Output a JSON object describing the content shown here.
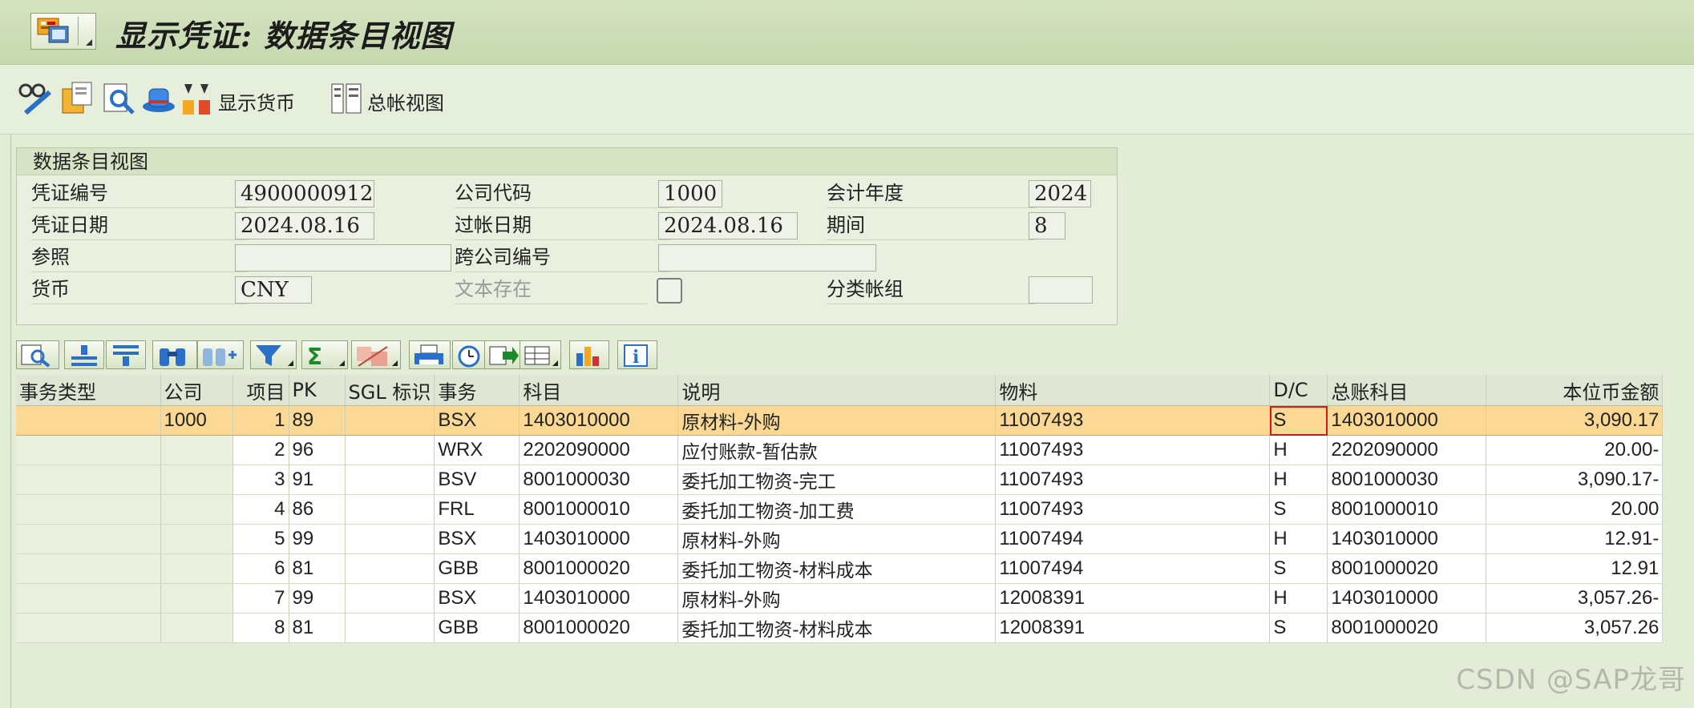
{
  "window": {
    "title": "显示凭证: 数据条目视图"
  },
  "toolbar": {
    "display_currency_label": "显示货币",
    "gl_view_label": "总帐视图"
  },
  "header": {
    "group_title": "数据条目视图",
    "doc_number_label": "凭证编号",
    "doc_number": "4900000912",
    "company_code_label": "公司代码",
    "company_code": "1000",
    "fiscal_year_label": "会计年度",
    "fiscal_year": "2024",
    "doc_date_label": "凭证日期",
    "doc_date": "2024.08.16",
    "posting_date_label": "过帐日期",
    "posting_date": "2024.08.16",
    "period_label": "期间",
    "period": "8",
    "reference_label": "参照",
    "reference": "",
    "cross_company_label": "跨公司编号",
    "cross_company": "",
    "currency_label": "货币",
    "currency": "CNY",
    "text_exists_label": "文本存在",
    "ledger_group_label": "分类帐组",
    "ledger_group": ""
  },
  "grid": {
    "columns": [
      "事务类型",
      "公司",
      "项目",
      "PK",
      "SGL 标识",
      "事务",
      "科目",
      "说明",
      "物料",
      "D/C",
      "总账科目",
      "本位币金额"
    ],
    "rows": [
      [
        "",
        "1000",
        "1",
        "89",
        "",
        "BSX",
        "1403010000",
        "原材料-外购",
        "11007493",
        "S",
        "1403010000",
        "3,090.17"
      ],
      [
        "",
        "",
        "2",
        "96",
        "",
        "WRX",
        "2202090000",
        "应付账款-暂估款",
        "11007493",
        "H",
        "2202090000",
        "20.00-"
      ],
      [
        "",
        "",
        "3",
        "91",
        "",
        "BSV",
        "8001000030",
        "委托加工物资-完工",
        "11007493",
        "H",
        "8001000030",
        "3,090.17-"
      ],
      [
        "",
        "",
        "4",
        "86",
        "",
        "FRL",
        "8001000010",
        "委托加工物资-加工费",
        "11007493",
        "S",
        "8001000010",
        "20.00"
      ],
      [
        "",
        "",
        "5",
        "99",
        "",
        "BSX",
        "1403010000",
        "原材料-外购",
        "11007494",
        "H",
        "1403010000",
        "12.91-"
      ],
      [
        "",
        "",
        "6",
        "81",
        "",
        "GBB",
        "8001000020",
        "委托加工物资-材料成本",
        "11007494",
        "S",
        "8001000020",
        "12.91"
      ],
      [
        "",
        "",
        "7",
        "99",
        "",
        "BSX",
        "1403010000",
        "原材料-外购",
        "12008391",
        "H",
        "1403010000",
        "3,057.26-"
      ],
      [
        "",
        "",
        "8",
        "81",
        "",
        "GBB",
        "8001000020",
        "委托加工物资-材料成本",
        "12008391",
        "S",
        "8001000020",
        "3,057.26"
      ]
    ]
  },
  "watermark": "CSDN @SAP龙哥",
  "colors": {
    "selected_row": "#fbd894",
    "background": "#e3ecd6",
    "title_bar": "#c6d8ae"
  }
}
